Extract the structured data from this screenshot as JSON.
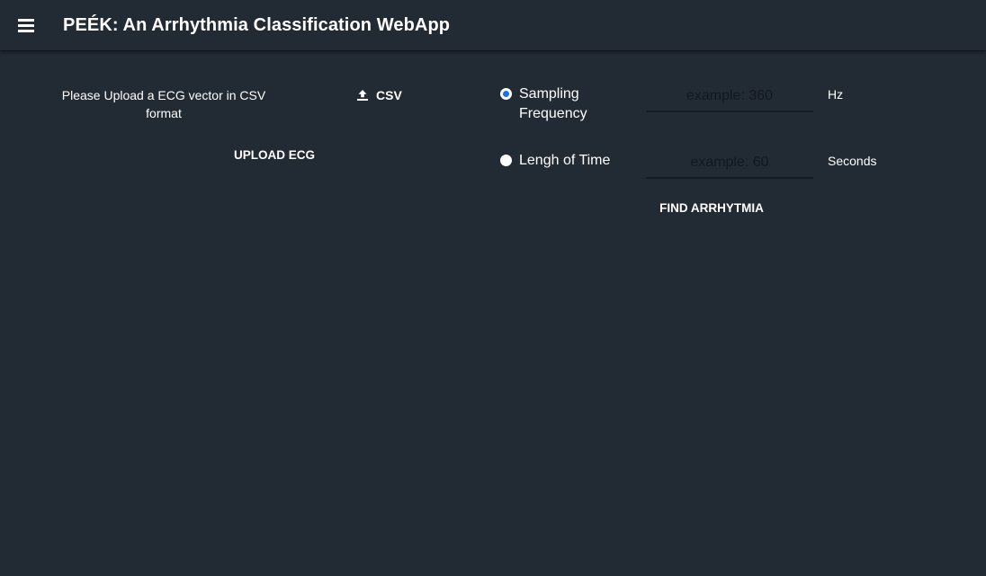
{
  "app": {
    "title": "PEÉK: An Arrhythmia Classification WebApp",
    "menu_icon": "hamburger-menu-icon"
  },
  "upload": {
    "instruction": "Please Upload a ECG vector in CSV format",
    "csv_button_label": "CSV",
    "csv_button_icon": "upload-icon",
    "upload_button_label": "UPLOAD ECG"
  },
  "options": [
    {
      "label": "Sampling Frequency",
      "selected": true,
      "placeholder": "example: 360",
      "unit": "Hz"
    },
    {
      "label": "Lengh of Time",
      "selected": false,
      "placeholder": "example: 60",
      "unit": "Seconds"
    }
  ],
  "actions": {
    "find_label": "FIND ARRHYTMIA"
  },
  "colors": {
    "background": "#222a33",
    "text": "#ffffff",
    "radio_accent": "#1a73e8"
  }
}
